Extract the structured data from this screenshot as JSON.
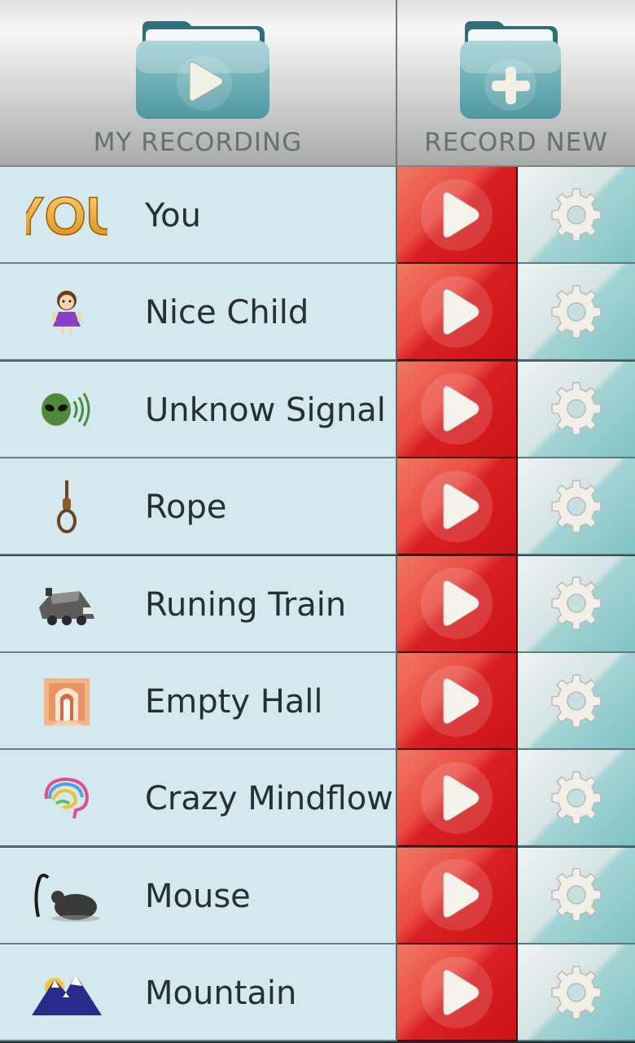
{
  "header": {
    "my_recording_label": "MY RECORDING",
    "record_new_label": "RECORD NEW",
    "my_recording_icon": "play-folder-icon",
    "record_new_icon": "add-folder-icon"
  },
  "rows": [
    {
      "label": "You",
      "icon": "you-text-icon"
    },
    {
      "label": "Nice Child",
      "icon": "girl-icon"
    },
    {
      "label": "Unknow Signal",
      "icon": "alien-signal-icon"
    },
    {
      "label": "Rope",
      "icon": "noose-icon"
    },
    {
      "label": "Runing Train",
      "icon": "train-icon"
    },
    {
      "label": "Empty Hall",
      "icon": "hall-icon"
    },
    {
      "label": "Crazy Mindflow",
      "icon": "brain-icon"
    },
    {
      "label": "Mouse",
      "icon": "mouse-icon"
    },
    {
      "label": "Mountain",
      "icon": "mountain-icon"
    }
  ],
  "icon_text": {
    "you": "YOU"
  },
  "colors": {
    "row_bg": "#d3e9ed",
    "play_red": "#d82022",
    "gear_teal": "#7fc4c6",
    "text": "#25302f"
  }
}
